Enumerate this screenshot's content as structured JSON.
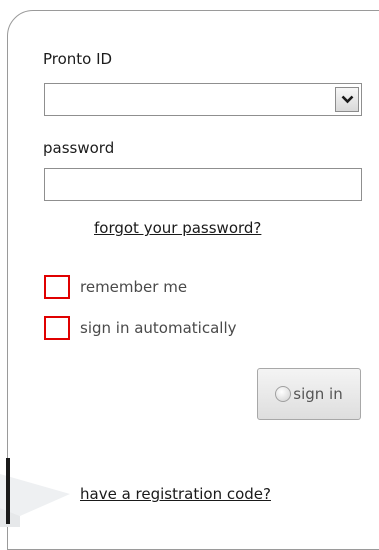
{
  "login": {
    "id_label": "Pronto ID",
    "id_value": "",
    "password_label": "password",
    "password_value": "",
    "forgot_link": "forgot your password?",
    "remember_label": "remember me",
    "auto_label": "sign in automatically",
    "remember_checked": false,
    "auto_checked": false,
    "signin_label": "sign in",
    "registration_link": "have a registration code?"
  },
  "icons": {
    "dropdown": "chevron-down-icon",
    "signin": "radio-circle-icon",
    "background": "graduation-cap-icon"
  },
  "colors": {
    "checkbox_border": "#e00000",
    "panel_border": "#9a9a9a"
  }
}
